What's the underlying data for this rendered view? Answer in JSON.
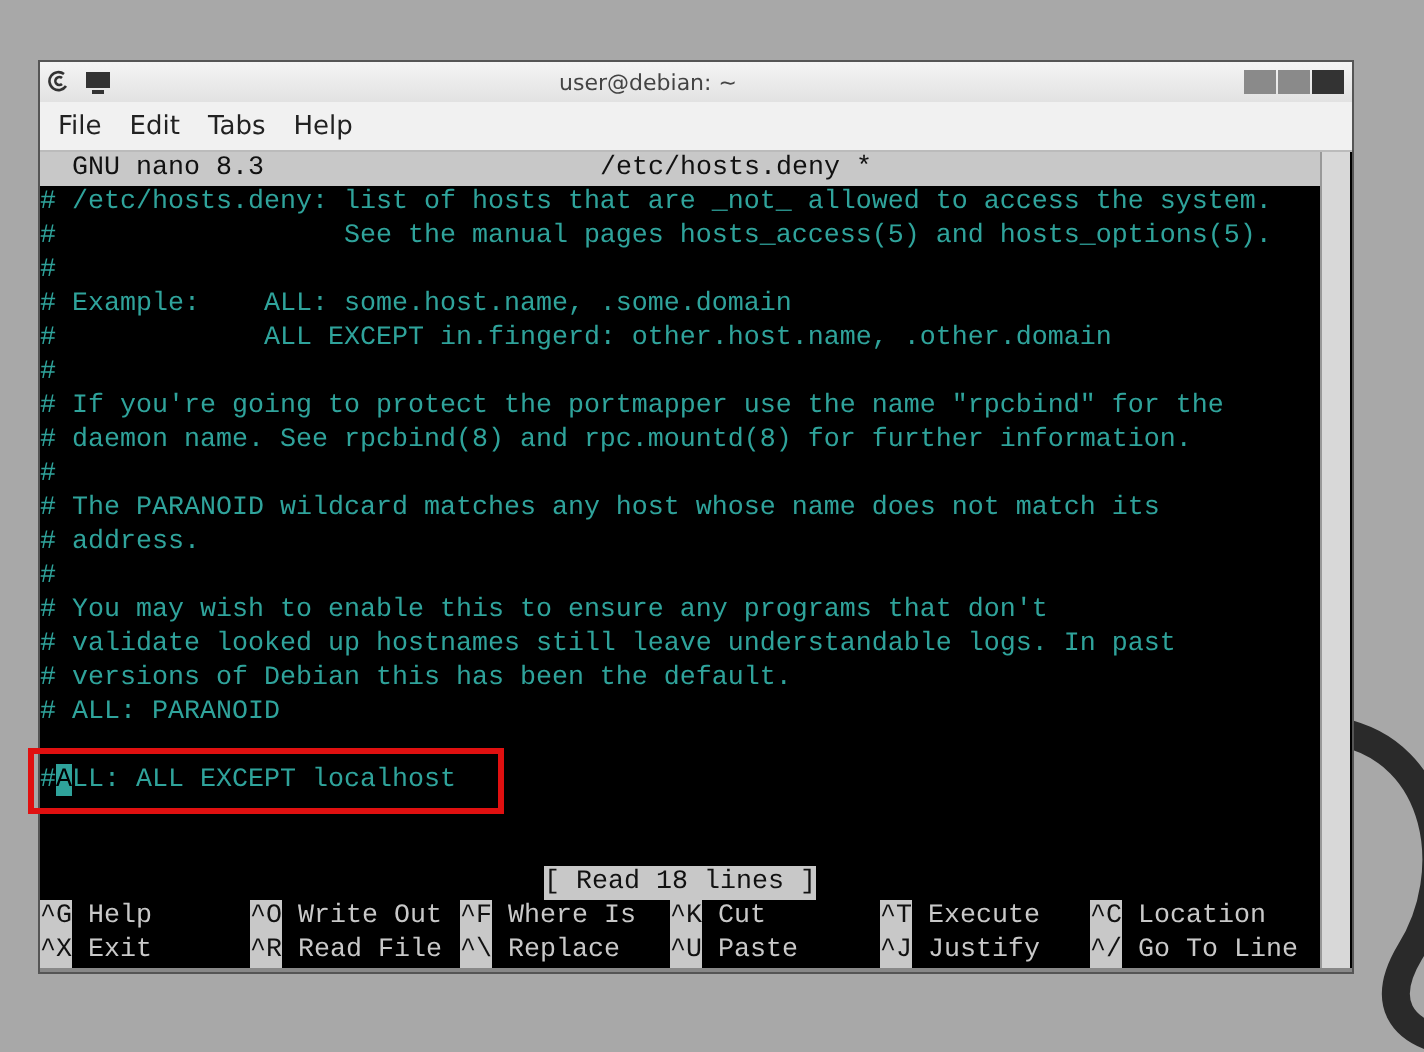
{
  "window": {
    "title": "user@debian: ~"
  },
  "menu": [
    "File",
    "Edit",
    "Tabs",
    "Help"
  ],
  "nano": {
    "version": "GNU nano 8.3",
    "filename": "/etc/hosts.deny *"
  },
  "lines": [
    {
      "kind": "text",
      "text": "# /etc/hosts.deny: list of hosts that are _not_ allowed to access the system."
    },
    {
      "kind": "text",
      "text": "#                  See the manual pages hosts_access(5) and hosts_options(5)."
    },
    {
      "kind": "text",
      "text": "#"
    },
    {
      "kind": "text",
      "text": "# Example:    ALL: some.host.name, .some.domain"
    },
    {
      "kind": "text",
      "text": "#             ALL EXCEPT in.fingerd: other.host.name, .other.domain"
    },
    {
      "kind": "text",
      "text": "#"
    },
    {
      "kind": "text",
      "text": "# If you're going to protect the portmapper use the name \"rpcbind\" for the"
    },
    {
      "kind": "text",
      "text": "# daemon name. See rpcbind(8) and rpc.mountd(8) for further information."
    },
    {
      "kind": "text",
      "text": "#"
    },
    {
      "kind": "text",
      "text": "# The PARANOID wildcard matches any host whose name does not match its"
    },
    {
      "kind": "text",
      "text": "# address."
    },
    {
      "kind": "text",
      "text": "#"
    },
    {
      "kind": "text",
      "text": "# You may wish to enable this to ensure any programs that don't"
    },
    {
      "kind": "text",
      "text": "# validate looked up hostnames still leave understandable logs. In past"
    },
    {
      "kind": "text",
      "text": "# versions of Debian this has been the default."
    },
    {
      "kind": "text",
      "text": "# ALL: PARANOID"
    },
    {
      "kind": "blank"
    },
    {
      "kind": "text",
      "text": "#ALL: ALL EXCEPT localhost",
      "cursor": true,
      "highlighted": true
    }
  ],
  "status": "[ Read 18 lines ]",
  "shortcuts": [
    {
      "key": "^G",
      "label": "Help"
    },
    {
      "key": "^O",
      "label": "Write Out"
    },
    {
      "key": "^F",
      "label": "Where Is"
    },
    {
      "key": "^K",
      "label": "Cut"
    },
    {
      "key": "^T",
      "label": "Execute"
    },
    {
      "key": "^C",
      "label": "Location"
    },
    {
      "key": "^X",
      "label": "Exit"
    },
    {
      "key": "^R",
      "label": "Read File"
    },
    {
      "key": "^\\",
      "label": "Replace"
    },
    {
      "key": "^U",
      "label": "Paste"
    },
    {
      "key": "^J",
      "label": "Justify"
    },
    {
      "key": "^/",
      "label": "Go To Line"
    }
  ]
}
